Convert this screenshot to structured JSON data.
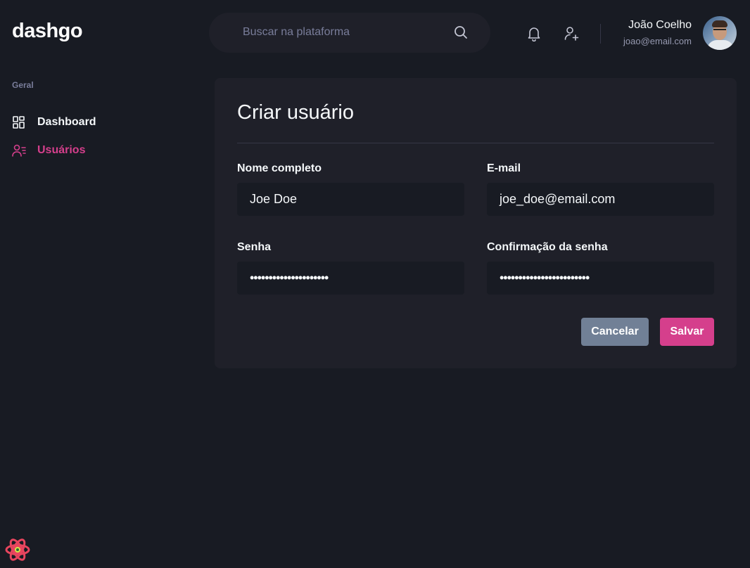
{
  "header": {
    "logo": "dashgo",
    "search": {
      "placeholder": "Buscar na plataforma",
      "icon": "search-icon"
    },
    "actions": [
      {
        "icon": "bell-icon"
      },
      {
        "icon": "user-add-icon"
      }
    ],
    "user": {
      "name": "João Coelho",
      "email": "joao@email.com",
      "avatar": "avatar-photo"
    }
  },
  "sidebar": {
    "section": "Geral",
    "items": [
      {
        "label": "Dashboard",
        "icon": "dashboard-icon",
        "active": false
      },
      {
        "label": "Usuários",
        "icon": "users-icon",
        "active": true
      }
    ]
  },
  "form": {
    "title": "Criar usuário",
    "fields": {
      "name": {
        "label": "Nome completo",
        "value": "Joe Doe"
      },
      "email": {
        "label": "E-mail",
        "value": "joe_doe@email.com"
      },
      "password": {
        "label": "Senha",
        "value": "•••••••••••••••••••••"
      },
      "password_confirm": {
        "label": "Confirmação da senha",
        "value": "••••••••••••••••••••••••"
      }
    },
    "buttons": {
      "cancel": "Cancelar",
      "save": "Salvar"
    }
  },
  "colors": {
    "background": "#181b23",
    "card": "#1f2029",
    "accent": "#d53f8c",
    "muted": "#797d9a",
    "cancel": "#718096"
  }
}
